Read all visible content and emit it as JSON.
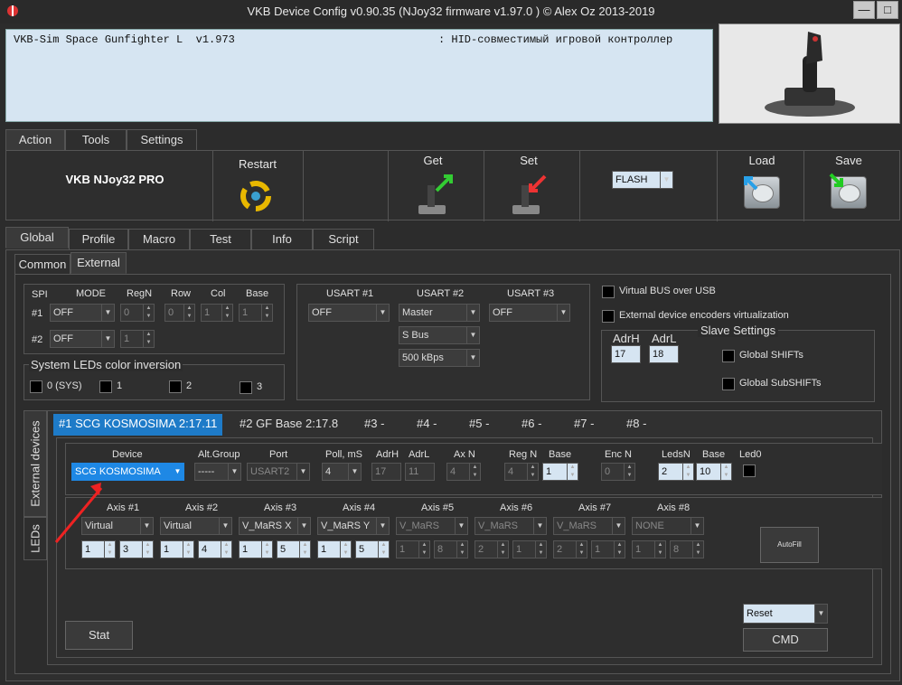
{
  "window": {
    "title": "VKB Device Config v0.90.35 (NJoy32 firmware v1.97.0  ) © Alex Oz 2013-2019",
    "min": "—",
    "max": "□",
    "close": "✕"
  },
  "device_list": {
    "name": "VKB-Sim Space Gunfighter L  v1.973",
    "desc": ": HID-совместимый игровой контроллер"
  },
  "main_tabs": [
    "Action",
    "Tools",
    "Settings"
  ],
  "toolbar": {
    "device_name": "VKB NJoy32 PRO",
    "restart": "Restart",
    "get": "Get",
    "set": "Set",
    "memory": "FLASH",
    "load": "Load",
    "save": "Save"
  },
  "sub_tabs": [
    "Global",
    "Profile",
    "Macro",
    "Test",
    "Info",
    "Script"
  ],
  "inner_tabs": [
    "Common",
    "External"
  ],
  "spi": {
    "headers": [
      "SPI",
      "MODE",
      "RegN",
      "Row",
      "Col",
      "Base"
    ],
    "row1": {
      "label": "#1",
      "mode": "OFF",
      "regn": "0",
      "row": "0",
      "col": "1",
      "base": "1"
    },
    "row2": {
      "label": "#2",
      "mode": "OFF",
      "regn": "1"
    }
  },
  "leds_inv": {
    "title": "System LEDs color inversion",
    "items": [
      "0 (SYS)",
      "1",
      "2",
      "3"
    ]
  },
  "usart": {
    "headers": [
      "USART #1",
      "USART #2",
      "USART #3"
    ],
    "u1": "OFF",
    "u2": "Master",
    "u3": "OFF",
    "bus": "S Bus",
    "speed": "500 kBps"
  },
  "virtual": {
    "bus": "Virtual BUS over USB",
    "encoders": "External device encoders virtualization"
  },
  "slave": {
    "title": "Slave Settings",
    "adrh_label": "AdrH",
    "adrl_label": "AdrL",
    "adrh": "17",
    "adrl": "18",
    "shifts": "Global SHIFTs",
    "subshifts": "Global SubSHIFTs"
  },
  "devices_tabs": [
    "#1 SCG KOSMOSIMA 2:17.11",
    "#2 GF Base 2:17.8",
    "#3 -",
    "#4 -",
    "#5 -",
    "#6 -",
    "#7 -",
    "#8 -"
  ],
  "vtabs": {
    "external": "External devices",
    "leds": "LEDs"
  },
  "dev_headers": {
    "device": "Device",
    "altgroup": "Alt.Group",
    "port": "Port",
    "poll": "Poll, mS",
    "adrh": "AdrH",
    "adrl": "AdrL",
    "axn": "Ax N",
    "regn": "Reg N",
    "base": "Base",
    "encn": "Enc N",
    "ledsn": "LedsN",
    "base2": "Base",
    "led0": "Led0"
  },
  "dev_values": {
    "device": "SCG KOSMOSIMA",
    "altgroup": "-----",
    "port": "USART2",
    "poll": "4",
    "adrh": "17",
    "adrl": "11",
    "axn": "4",
    "regn": "4",
    "base": "1",
    "encn": "0",
    "ledsn": "2",
    "base2": "10"
  },
  "axes": [
    {
      "label": "Axis #1",
      "type": "Virtual",
      "a": "1",
      "b": "3"
    },
    {
      "label": "Axis #2",
      "type": "Virtual",
      "a": "1",
      "b": "4"
    },
    {
      "label": "Axis #3",
      "type": "V_MaRS X",
      "a": "1",
      "b": "5"
    },
    {
      "label": "Axis #4",
      "type": "V_MaRS Y",
      "a": "1",
      "b": "5"
    },
    {
      "label": "Axis #5",
      "type": "V_MaRS",
      "a": "1",
      "b": "8"
    },
    {
      "label": "Axis #6",
      "type": "V_MaRS",
      "a": "2",
      "b": "1"
    },
    {
      "label": "Axis #7",
      "type": "V_MaRS",
      "a": "2",
      "b": "1"
    },
    {
      "label": "Axis #8",
      "type": "NONE",
      "a": "1",
      "b": "8"
    }
  ],
  "autofill": "AutoFill",
  "stat": "Stat",
  "reset": "Reset",
  "cmd": "CMD"
}
